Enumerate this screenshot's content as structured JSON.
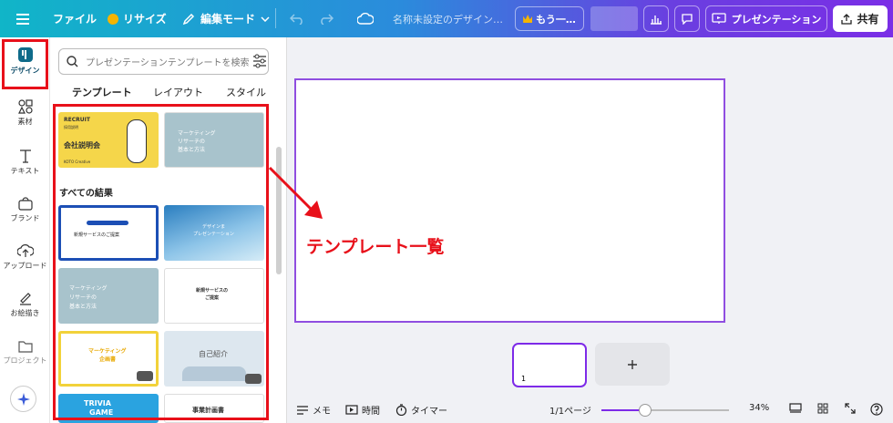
{
  "topbar": {
    "menu_file": "ファイル",
    "resize": "リサイズ",
    "edit_mode": "編集モード",
    "doc_title": "名称未設定のデザイン…",
    "upgrade": "もう一…",
    "present": "プレゼンテーション",
    "share": "共有"
  },
  "leftnav": {
    "items": [
      {
        "label": "デザイン"
      },
      {
        "label": "素材"
      },
      {
        "label": "テキスト"
      },
      {
        "label": "ブランド"
      },
      {
        "label": "アップロード"
      },
      {
        "label": "お絵描き"
      },
      {
        "label": "プロジェクト"
      }
    ]
  },
  "panel": {
    "search_placeholder": "プレゼンテーションテンプレートを検索",
    "tabs": [
      "テンプレート",
      "レイアウト",
      "スタイル"
    ],
    "section_all": "すべての結果",
    "templates": [
      {
        "line1": "RECRUIT",
        "line2": "採用説明",
        "line3": "会社説明会",
        "line4": "KOTO Creative"
      },
      {
        "line1": "マーケティング",
        "line2": "リサーチの",
        "line3": "基本と方法"
      },
      {
        "line1": "新規サービスのご提案"
      },
      {
        "line1": "デザインま",
        "line2": "プレゼンテーション"
      },
      {
        "line1": "マーケティング",
        "line2": "リサーチの",
        "line3": "基本と方法"
      },
      {
        "line1": "新規サービスの",
        "line2": "ご提案"
      },
      {
        "line1": "マーケティング",
        "line2": "企画書"
      },
      {
        "line1": "自己紹介"
      },
      {
        "line1": "TRIVIA",
        "line2": "GAME"
      },
      {
        "line1": "事業計画書"
      }
    ]
  },
  "annotation": {
    "label": "テンプレート一覧"
  },
  "canvas": {
    "page_number": "1"
  },
  "bottombar": {
    "notes": "メモ",
    "time": "時間",
    "timer": "タイマー",
    "pages": "1/1ページ",
    "zoom": "34%"
  },
  "colors": {
    "accent_red": "#e8101a",
    "accent_purple": "#7d2ae8"
  }
}
